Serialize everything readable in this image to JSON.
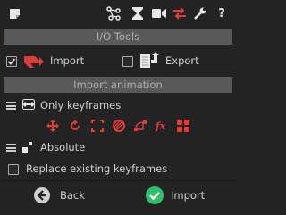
{
  "window": {
    "sections": {
      "io_tools": "I/O Tools",
      "import_animation": "Import animation"
    }
  },
  "toolbar": {
    "icons": [
      "note-icon",
      "tree-icon",
      "hourglass-icon",
      "camera-icon",
      "swap-arrows-icon",
      "wrench-icon",
      "help-icon"
    ],
    "accent_color": "#e03c3c"
  },
  "io": {
    "import_label": "Import",
    "import_checked": true,
    "export_label": "Export",
    "export_checked": false
  },
  "import_animation": {
    "keyframes_mode": "Only keyframes",
    "property_icons": [
      "move-icon",
      "rotate-icon",
      "scale-icon",
      "opacity-icon",
      "bezier-icon",
      "fx-icon",
      "grid-icon"
    ],
    "position_mode": "Absolute",
    "replace_label": "Replace existing keyframes",
    "replace_checked": false
  },
  "footer": {
    "back_label": "Back",
    "import_label": "Import",
    "import_icon_color": "#2fbf6a"
  }
}
